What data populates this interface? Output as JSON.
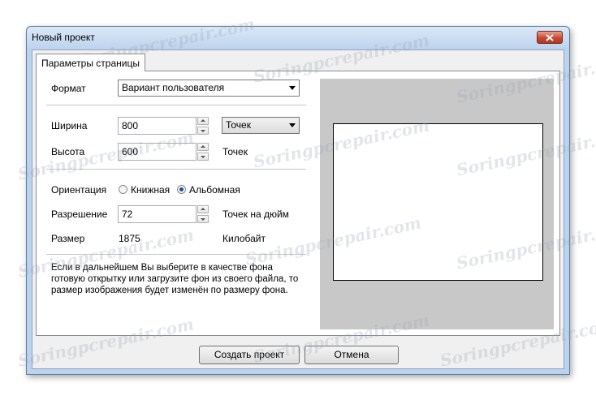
{
  "window": {
    "title": "Новый проект"
  },
  "tabs": [
    {
      "label": "Параметры страницы"
    }
  ],
  "format": {
    "label": "Формат",
    "value": "Вариант пользователя"
  },
  "width": {
    "label": "Ширина",
    "value": "800",
    "unit": "Точек"
  },
  "height": {
    "label": "Высота",
    "value": "600",
    "unit": "Точек"
  },
  "orientation": {
    "label": "Ориентация",
    "portrait": "Книжная",
    "landscape": "Альбомная",
    "selected": "landscape"
  },
  "resolution": {
    "label": "Разрешение",
    "value": "72",
    "unit": "Точек на дюйм"
  },
  "size": {
    "label": "Размер",
    "value": "1875",
    "unit": "Килобайт"
  },
  "note": "Если в дальнейшем Вы выберите в качестве фона готовую открытку или  загрузите фон  из своего файла,  то  размер изображения будет  изменён по размеру фона.",
  "buttons": {
    "create": "Создать проект",
    "cancel": "Отмена"
  },
  "watermark": "Soringpcrepair.com",
  "colors": {
    "close_button": "#c94a32",
    "preview_bg": "#c8c8c8",
    "titlebar": "#bfd4ee"
  }
}
